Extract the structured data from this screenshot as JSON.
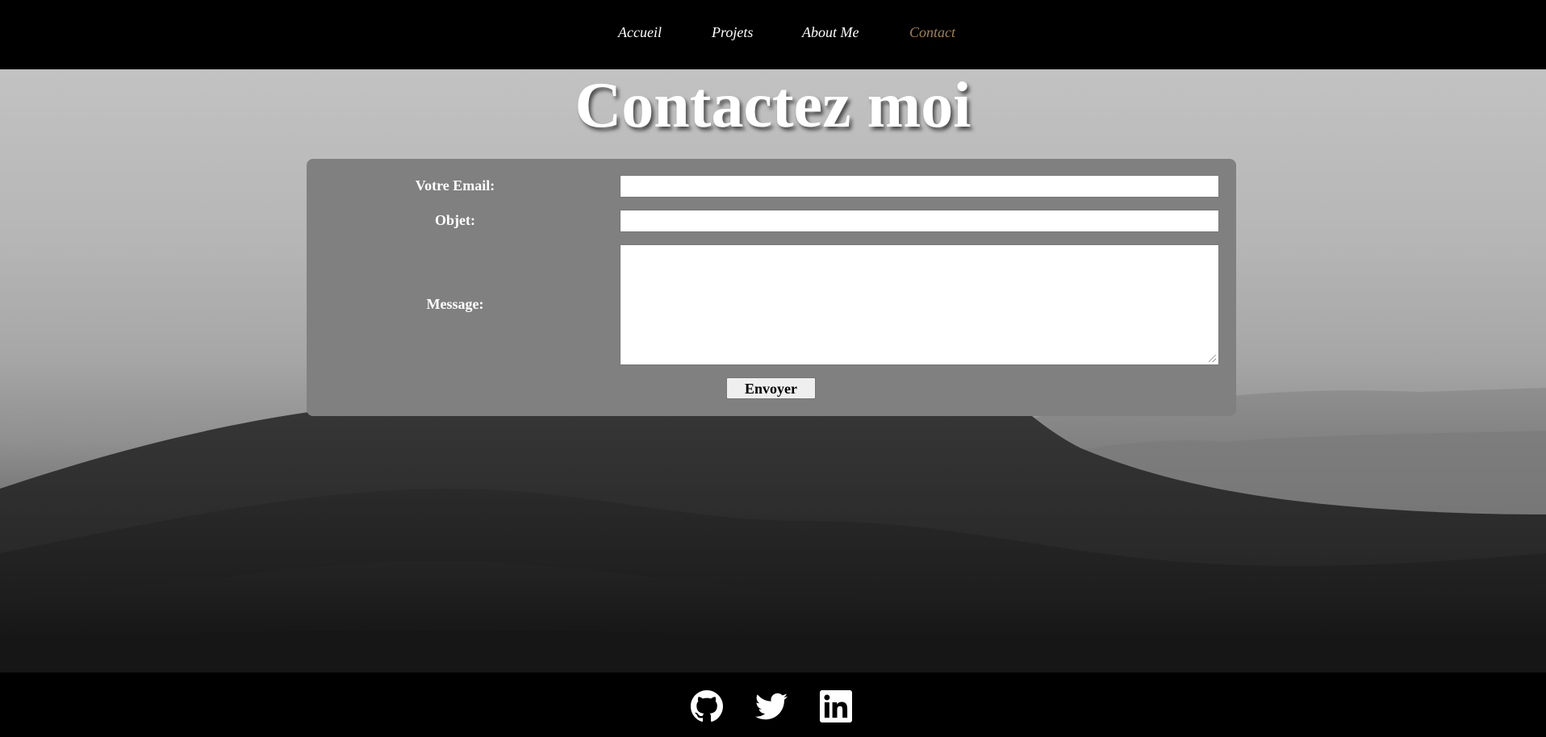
{
  "nav": {
    "items": [
      {
        "label": "Accueil",
        "active": false
      },
      {
        "label": "Projets",
        "active": false
      },
      {
        "label": "About Me",
        "active": false
      },
      {
        "label": "Contact",
        "active": true
      }
    ],
    "active_color": "#a0814f"
  },
  "page": {
    "title": "Contactez moi"
  },
  "form": {
    "email_label": "Votre Email:",
    "email_value": "",
    "subject_label": "Objet:",
    "subject_value": "",
    "message_label": "Message:",
    "message_value": "",
    "submit_label": "Envoyer",
    "panel_color": "#808080"
  },
  "footer": {
    "social": [
      {
        "icon": "github-icon"
      },
      {
        "icon": "twitter-icon"
      },
      {
        "icon": "linkedin-icon"
      }
    ]
  }
}
